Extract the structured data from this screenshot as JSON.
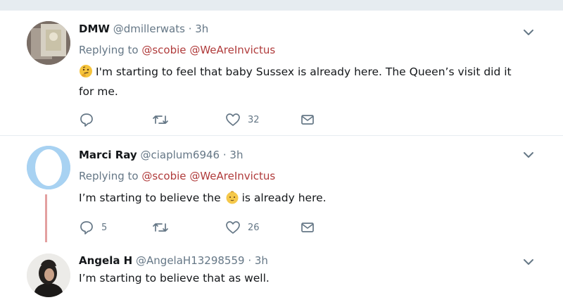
{
  "tweets": [
    {
      "name": "DMW",
      "handle": "@dmillerwats",
      "dot": "·",
      "time": "3h",
      "replying_prefix": "Replying to",
      "mentions": [
        "@scobie",
        "@WeAreInvictus"
      ],
      "text_emoji": "thinking-face-emoji",
      "text_line1": "I'm starting to feel that baby Sussex is already here. The Queen’s visit did it",
      "text_line2": "for me.",
      "reply_count": "",
      "retweet_count": "",
      "like_count": "32"
    },
    {
      "name": "Marci Ray",
      "handle": "@ciaplum6946",
      "dot": "·",
      "time": "3h",
      "replying_prefix": "Replying to",
      "mentions": [
        "@scobie",
        "@WeAreInvictus"
      ],
      "text_before": "I’m starting to believe the",
      "text_emoji": "baby-emoji",
      "text_after": "is already here.",
      "reply_count": "5",
      "retweet_count": "",
      "like_count": "26"
    },
    {
      "name": "Angela H",
      "handle": "@AngelaH13298559",
      "dot": "·",
      "time": "3h",
      "text": "I’m starting to believe that as well."
    }
  ],
  "colors": {
    "mention": "#b03b3b",
    "secondary": "#657786",
    "thread_line": "#e3a0a0",
    "divider": "#e6ecf0"
  }
}
